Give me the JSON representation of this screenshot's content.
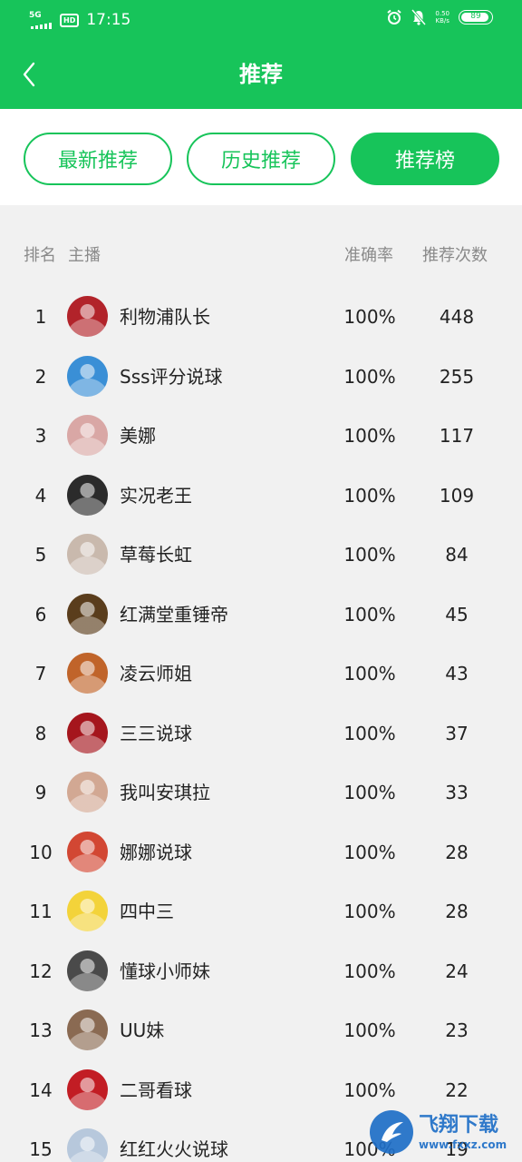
{
  "status_bar": {
    "network": "5G",
    "hd": "HD",
    "time": "17:15",
    "speed_value": "0.50",
    "speed_unit": "KB/s",
    "battery": "89"
  },
  "header": {
    "title": "推荐"
  },
  "tabs": [
    {
      "label": "最新推荐",
      "active": false
    },
    {
      "label": "历史推荐",
      "active": false
    },
    {
      "label": "推荐榜",
      "active": true
    }
  ],
  "table": {
    "columns": {
      "rank": "排名",
      "host": "主播",
      "accuracy": "准确率",
      "count": "推荐次数"
    },
    "rows": [
      {
        "rank": "1",
        "name": "利物浦队长",
        "accuracy": "100%",
        "count": "448",
        "avatar_color": "#b2232a"
      },
      {
        "rank": "2",
        "name": "Sss评分说球",
        "accuracy": "100%",
        "count": "255",
        "avatar_color": "#3a8fd6"
      },
      {
        "rank": "3",
        "name": "美娜",
        "accuracy": "100%",
        "count": "117",
        "avatar_color": "#d9a7a5"
      },
      {
        "rank": "4",
        "name": "实况老王",
        "accuracy": "100%",
        "count": "109",
        "avatar_color": "#2b2b2b"
      },
      {
        "rank": "5",
        "name": "草莓长虹",
        "accuracy": "100%",
        "count": "84",
        "avatar_color": "#c9b9ad"
      },
      {
        "rank": "6",
        "name": "红满堂重锤帝",
        "accuracy": "100%",
        "count": "45",
        "avatar_color": "#5a3d1c"
      },
      {
        "rank": "7",
        "name": "凌云师姐",
        "accuracy": "100%",
        "count": "43",
        "avatar_color": "#c0642a"
      },
      {
        "rank": "8",
        "name": "三三说球",
        "accuracy": "100%",
        "count": "37",
        "avatar_color": "#a5161d"
      },
      {
        "rank": "9",
        "name": "我叫安琪拉",
        "accuracy": "100%",
        "count": "33",
        "avatar_color": "#d2a893"
      },
      {
        "rank": "10",
        "name": "娜娜说球",
        "accuracy": "100%",
        "count": "28",
        "avatar_color": "#d24733"
      },
      {
        "rank": "11",
        "name": "四中三",
        "accuracy": "100%",
        "count": "28",
        "avatar_color": "#f3d33a"
      },
      {
        "rank": "12",
        "name": "懂球小师妹",
        "accuracy": "100%",
        "count": "24",
        "avatar_color": "#4a4a4a"
      },
      {
        "rank": "13",
        "name": "UU妹",
        "accuracy": "100%",
        "count": "23",
        "avatar_color": "#8a6a52"
      },
      {
        "rank": "14",
        "name": "二哥看球",
        "accuracy": "100%",
        "count": "22",
        "avatar_color": "#c21d24"
      },
      {
        "rank": "15",
        "name": "红红火火说球",
        "accuracy": "100%",
        "count": "19",
        "avatar_color": "#b7c8dc"
      }
    ]
  },
  "watermark": {
    "text": "飞翔下载",
    "url": "www.fxxz.com"
  },
  "colors": {
    "brand_green": "#17c45a",
    "background": "#f1f1f1"
  }
}
